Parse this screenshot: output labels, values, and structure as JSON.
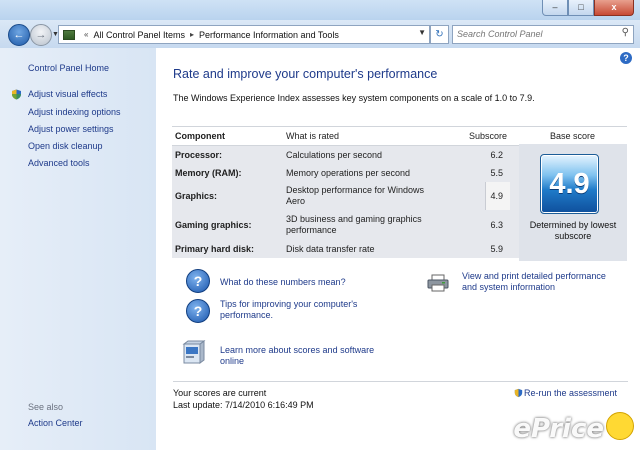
{
  "window": {
    "controls": [
      "–",
      "□",
      "x"
    ]
  },
  "nav": {
    "crumbs": [
      "All Control Panel Items",
      "Performance Information and Tools"
    ],
    "search_placeholder": "Search Control Panel"
  },
  "sidebar": {
    "home": "Control Panel Home",
    "items": [
      "Adjust visual effects",
      "Adjust indexing options",
      "Adjust power settings",
      "Open disk cleanup",
      "Advanced tools"
    ],
    "see_also": "See also",
    "action_center": "Action Center"
  },
  "main": {
    "title": "Rate and improve your computer's performance",
    "description": "The Windows Experience Index assesses key system components on a scale of 1.0 to 7.9.",
    "table": {
      "headers": [
        "Component",
        "What is rated",
        "Subscore",
        "Base score"
      ],
      "rows": [
        {
          "component": "Processor:",
          "rated": "Calculations per second",
          "subscore": "6.2"
        },
        {
          "component": "Memory (RAM):",
          "rated": "Memory operations per second",
          "subscore": "5.5"
        },
        {
          "component": "Graphics:",
          "rated": "Desktop performance for Windows Aero",
          "subscore": "4.9"
        },
        {
          "component": "Gaming graphics:",
          "rated": "3D business and gaming graphics performance",
          "subscore": "6.3"
        },
        {
          "component": "Primary hard disk:",
          "rated": "Disk data transfer rate",
          "subscore": "5.9"
        }
      ],
      "base_score": "4.9",
      "base_caption": "Determined by lowest subscore"
    },
    "links": {
      "numbers": "What do these numbers mean?",
      "tips": "Tips for improving your computer's performance.",
      "print": "View and print detailed performance and system information",
      "learn": "Learn more about scores and software online"
    },
    "status": "Your scores are current",
    "last_update": "Last update: 7/14/2010 6:16:49 PM",
    "rerun": "Re-run the assessment"
  },
  "watermark": "ePrice"
}
